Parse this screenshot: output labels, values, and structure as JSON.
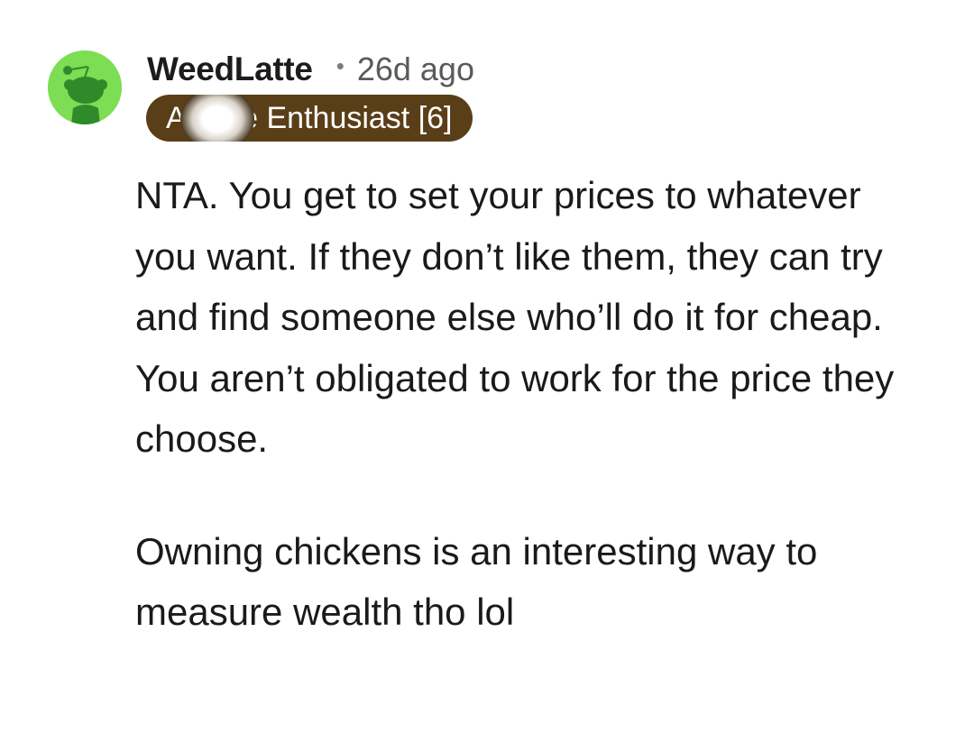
{
  "comment": {
    "username": "WeedLatte",
    "separator": "•",
    "timestamp": "26d ago",
    "flair": "A—ole Enthusiast [6]",
    "paragraphs": [
      "NTA. You get to set your prices to whatever you want. If they don’t like them, they can try and find someone else who’ll do it for cheap. You aren’t obligated to work for the price they choose.",
      "Owning chickens is an interesting way to measure wealth tho lol"
    ]
  },
  "colors": {
    "avatar_bg": "#7ddd53",
    "flair_bg": "#5a3e17",
    "username": "#1c1c1c",
    "timestamp": "#5a5a5a"
  },
  "icons": {
    "avatar": "snoo-avatar-icon"
  }
}
